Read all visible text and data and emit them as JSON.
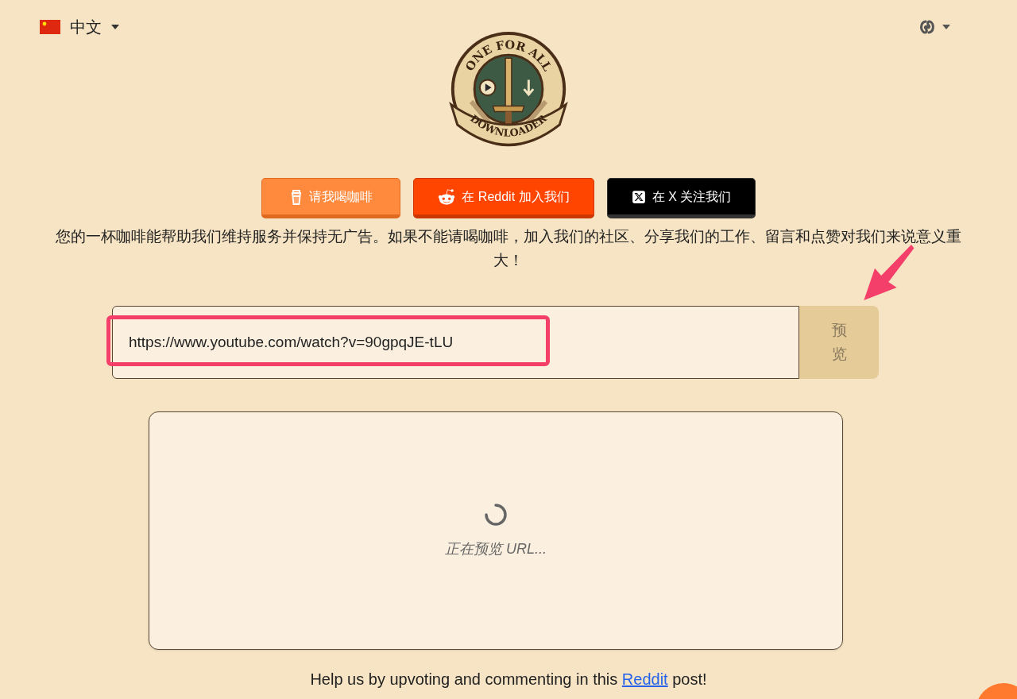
{
  "language": {
    "label": "中文"
  },
  "logo": {
    "top_text": "ONE FOR ALL",
    "bottom_text": "DOWNLOADER"
  },
  "buttons": [
    {
      "label": "请我喝咖啡",
      "kind": "coffee"
    },
    {
      "label": "在 Reddit 加入我们",
      "kind": "reddit"
    },
    {
      "label": "在 X 关注我们",
      "kind": "x"
    }
  ],
  "support_text": "您的一杯咖啡能帮助我们维持服务并保持无广告。如果不能请喝咖啡，加入我们的社区、分享我们的工作、留言和点赞对我们来说意义重大！",
  "url_input": {
    "value": "https://www.youtube.com/watch?v=90gpqJE-tLU"
  },
  "preview_button": {
    "label": "预览",
    "disabled": true
  },
  "preview_panel": {
    "status": "正在预览 URL..."
  },
  "footer": {
    "text_before": "Help us by upvoting and commenting in this",
    "link": "Reddit",
    "text_after": "post!"
  }
}
